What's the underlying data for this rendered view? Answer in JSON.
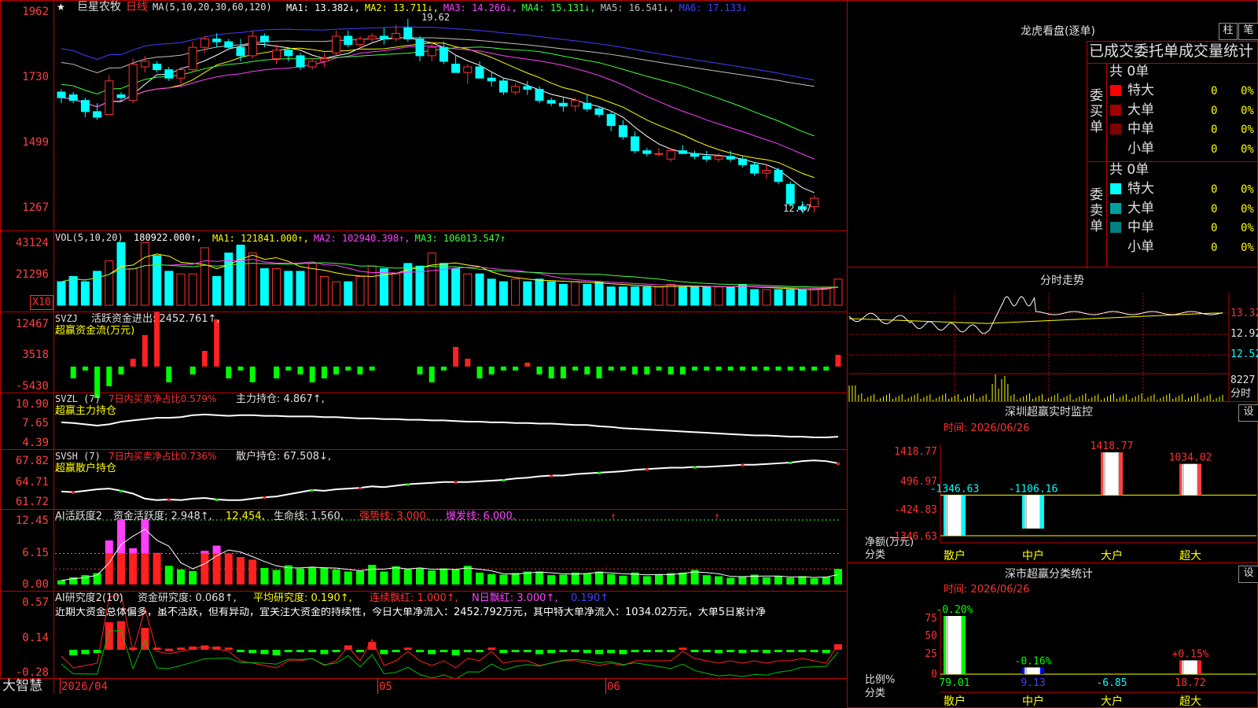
{
  "app": {
    "brand": "大智慧",
    "stock_name": "巨星农牧",
    "period": "日线",
    "star": "★"
  },
  "kline": {
    "y_labels": [
      "1962",
      "1730",
      "1499",
      "1267"
    ],
    "ma_header": "MA(5,10,20,30,60,120)",
    "ma": [
      {
        "label": "MA1: 13.382↓,",
        "color": "#ffffff"
      },
      {
        "label": "MA2: 13.711↓,",
        "color": "#ffff00"
      },
      {
        "label": "MA3: 14.266↓,",
        "color": "#ff40ff"
      },
      {
        "label": "MA4: 15.131↓,",
        "color": "#40ff40"
      },
      {
        "label": "MA5: 16.541↓,",
        "color": "#c0c0c0"
      },
      {
        "label": "MA6: 17.133↓",
        "color": "#4040ff"
      }
    ],
    "high_mark": "19.62",
    "low_mark": "12.67",
    "candles": [
      [
        17.0,
        17.1,
        16.6,
        16.8
      ],
      [
        16.9,
        17.0,
        16.6,
        16.7
      ],
      [
        16.7,
        16.8,
        16.1,
        16.3
      ],
      [
        16.3,
        16.6,
        16.0,
        16.1
      ],
      [
        16.2,
        17.6,
        16.2,
        17.4
      ],
      [
        16.9,
        17.0,
        16.7,
        16.8
      ],
      [
        16.7,
        18.2,
        16.6,
        18.0
      ],
      [
        17.9,
        18.3,
        17.7,
        18.1
      ],
      [
        18.0,
        18.1,
        17.7,
        17.8
      ],
      [
        17.8,
        17.9,
        17.4,
        17.5
      ],
      [
        17.5,
        17.9,
        17.3,
        17.8
      ],
      [
        17.8,
        18.8,
        17.7,
        18.6
      ],
      [
        18.6,
        19.0,
        18.4,
        18.9
      ],
      [
        18.9,
        19.1,
        18.6,
        18.8
      ],
      [
        18.8,
        18.9,
        18.5,
        18.6
      ],
      [
        18.6,
        18.9,
        18.1,
        18.3
      ],
      [
        18.3,
        19.2,
        18.2,
        19.0
      ],
      [
        19.0,
        19.1,
        18.6,
        18.8
      ],
      [
        18.2,
        18.7,
        18.0,
        18.5
      ],
      [
        18.5,
        18.6,
        18.1,
        18.3
      ],
      [
        18.3,
        18.4,
        17.8,
        17.9
      ],
      [
        17.9,
        18.2,
        17.8,
        18.1
      ],
      [
        18.1,
        18.4,
        17.9,
        18.2
      ],
      [
        18.4,
        19.2,
        18.3,
        19.0
      ],
      [
        19.0,
        19.2,
        18.6,
        18.7
      ],
      [
        18.7,
        19.0,
        18.5,
        18.9
      ],
      [
        18.9,
        19.1,
        18.8,
        19.0
      ],
      [
        19.0,
        19.3,
        18.7,
        18.9
      ],
      [
        18.9,
        19.4,
        18.8,
        19.1
      ],
      [
        19.3,
        19.62,
        18.8,
        18.9
      ],
      [
        18.9,
        19.0,
        18.1,
        18.3
      ],
      [
        18.3,
        18.8,
        18.1,
        18.6
      ],
      [
        18.6,
        18.8,
        18.0,
        18.1
      ],
      [
        18.0,
        18.3,
        17.8,
        17.7
      ],
      [
        17.7,
        18.0,
        17.3,
        17.9
      ],
      [
        17.9,
        18.1,
        17.5,
        17.5
      ],
      [
        17.5,
        17.7,
        17.2,
        17.4
      ],
      [
        17.4,
        17.5,
        16.9,
        17.0
      ],
      [
        17.0,
        17.3,
        16.9,
        17.2
      ],
      [
        17.2,
        17.4,
        16.9,
        17.1
      ],
      [
        17.1,
        17.2,
        16.6,
        16.7
      ],
      [
        16.7,
        16.8,
        16.5,
        16.6
      ],
      [
        16.6,
        16.8,
        16.3,
        16.5
      ],
      [
        16.5,
        16.8,
        16.3,
        16.7
      ],
      [
        16.6,
        16.9,
        16.3,
        16.4
      ],
      [
        16.4,
        16.5,
        16.1,
        16.2
      ],
      [
        16.2,
        16.3,
        15.6,
        15.8
      ],
      [
        15.8,
        16.0,
        15.3,
        15.4
      ],
      [
        15.4,
        15.6,
        14.8,
        14.9
      ],
      [
        14.9,
        15.0,
        14.7,
        14.8
      ],
      [
        14.8,
        15.0,
        14.7,
        14.8
      ],
      [
        14.6,
        15.0,
        14.5,
        14.9
      ],
      [
        14.9,
        15.1,
        14.8,
        14.8
      ],
      [
        14.8,
        14.9,
        14.6,
        14.7
      ],
      [
        14.7,
        14.9,
        14.5,
        14.6
      ],
      [
        14.6,
        14.8,
        14.5,
        14.7
      ],
      [
        14.7,
        14.9,
        14.5,
        14.6
      ],
      [
        14.6,
        14.7,
        14.3,
        14.4
      ],
      [
        14.4,
        14.5,
        14.0,
        14.1
      ],
      [
        14.1,
        14.4,
        13.9,
        14.2
      ],
      [
        14.2,
        14.3,
        13.7,
        13.8
      ],
      [
        13.7,
        13.8,
        12.9,
        13.0
      ],
      [
        12.9,
        13.1,
        12.67,
        12.8
      ],
      [
        12.9,
        13.3,
        12.7,
        13.2
      ]
    ]
  },
  "vol": {
    "header": "VOL(5,10,20)",
    "value": "180922.000↑,",
    "ma": [
      {
        "label": "MA1: 121841.000↑,",
        "color": "#ffff00"
      },
      {
        "label": "MA2: 102940.398↑,",
        "color": "#ff40ff"
      },
      {
        "label": "MA3: 106013.547↑",
        "color": "#40ff40"
      }
    ],
    "y_labels": [
      "43124",
      "21296",
      "X10"
    ],
    "bars": [
      9,
      11,
      9,
      13,
      17,
      24,
      14,
      24,
      19,
      13,
      12,
      12,
      22,
      11,
      20,
      23,
      20,
      14,
      14,
      13,
      13,
      16,
      11,
      9,
      9,
      11,
      15,
      14,
      12,
      16,
      15,
      20,
      16,
      14,
      12,
      12,
      10,
      9,
      10,
      9,
      10,
      9,
      8,
      9,
      8,
      9,
      7,
      7,
      7,
      7,
      7,
      8,
      7,
      7,
      7,
      7,
      7,
      8,
      6,
      6,
      6,
      6,
      6,
      6,
      7,
      10
    ]
  },
  "svzj": {
    "title": "SVZJ",
    "line1": "活跃资金进出: 2452.761↑,",
    "line2": "超赢资金流(万元)",
    "y_labels": [
      "12467",
      "3518",
      "-5430"
    ],
    "bars": [
      0,
      -3,
      -1,
      -8,
      -5,
      -2,
      2,
      8,
      14,
      -4,
      0,
      -2,
      4,
      12,
      -3,
      -1,
      -4,
      0,
      -3,
      -1,
      -2,
      -4,
      -3,
      -2,
      -1,
      -2,
      -1,
      0,
      0,
      0,
      -2,
      -4,
      -1,
      5,
      2,
      -3,
      -2,
      -1,
      -1,
      1,
      -2,
      -3,
      -3,
      -1,
      -2,
      -3,
      -1,
      -1,
      -2,
      -2,
      -1,
      -2,
      -2,
      -1,
      -1,
      -1,
      -1,
      -1,
      -1,
      -1,
      -1,
      -1,
      -1,
      -1,
      -1,
      3
    ],
    "bar_colors": [
      "#00ff00",
      "#ff2020"
    ]
  },
  "svzl": {
    "title": "SVZL (7)",
    "text_red": "7日内买卖净占比0.579%",
    "text": "主力持仓: 4.867↑,",
    "line2": "超赢主力持仓",
    "y_labels": [
      "10.90",
      "7.65",
      "4.39"
    ],
    "series": [
      7.9,
      7.8,
      7.6,
      7.4,
      7.6,
      8.0,
      8.2,
      8.4,
      8.6,
      8.6,
      8.7,
      9.0,
      9.1,
      9.0,
      8.9,
      9.0,
      9.0,
      8.9,
      8.9,
      8.8,
      8.8,
      8.8,
      8.7,
      8.7,
      8.6,
      8.5,
      8.5,
      8.4,
      8.4,
      8.3,
      8.3,
      8.2,
      8.2,
      8.1,
      8.0,
      8.0,
      7.9,
      7.9,
      7.8,
      7.8,
      7.7,
      7.7,
      7.6,
      7.5,
      7.5,
      7.3,
      7.2,
      7.0,
      6.9,
      6.8,
      6.7,
      6.6,
      6.5,
      6.4,
      6.3,
      6.2,
      6.1,
      6.0,
      5.9,
      5.9,
      5.8,
      5.7,
      5.7,
      5.6,
      5.6,
      5.7
    ]
  },
  "svsh": {
    "title": "SVSH (7)",
    "text_red": "7日内买卖净占比0.736%",
    "text": "散户持仓: 67.508↓,",
    "line2": "超赢散户持仓",
    "y_labels": [
      "67.82",
      "64.71",
      "61.72"
    ],
    "series": [
      63.6,
      63.5,
      63.7,
      63.9,
      64.0,
      63.7,
      63.3,
      62.6,
      62.4,
      62.5,
      62.4,
      62.6,
      62.7,
      62.5,
      62.4,
      62.4,
      62.6,
      62.8,
      62.9,
      63.2,
      63.5,
      63.8,
      63.7,
      63.9,
      64.0,
      64.1,
      64.3,
      64.2,
      64.4,
      64.6,
      64.7,
      64.8,
      64.9,
      64.9,
      64.9,
      65.0,
      65.1,
      65.2,
      65.4,
      65.5,
      65.7,
      65.8,
      65.8,
      66.0,
      66.1,
      66.2,
      66.3,
      66.4,
      66.6,
      66.7,
      66.8,
      66.9,
      66.9,
      67.0,
      67.0,
      67.1,
      67.2,
      67.3,
      67.3,
      67.4,
      67.5,
      67.6,
      67.8,
      67.9,
      67.8,
      67.5
    ]
  },
  "ai_active": {
    "title": "AI活跃度2",
    "line1": "资金活跃度: 2.948↑,",
    "val2": "12.454,",
    "life": "生命线: 1.560,",
    "strong": "强势线: 3.000,",
    "burst": "爆发线: 6.000,",
    "y_labels": [
      "12.45",
      "6.15",
      "0.00"
    ],
    "bars": [
      0.8,
      1.4,
      1.8,
      2.2,
      8.5,
      12.5,
      7.0,
      12.5,
      6.1,
      3.6,
      2.9,
      2.6,
      6.5,
      7.5,
      6.0,
      5.3,
      4.8,
      3.2,
      2.8,
      3.7,
      3.1,
      3.3,
      3.3,
      2.9,
      2.5,
      2.6,
      3.8,
      2.5,
      3.5,
      3.0,
      3.1,
      2.7,
      3.1,
      2.9,
      3.6,
      2.3,
      2.0,
      1.9,
      2.2,
      2.5,
      2.5,
      1.8,
      1.9,
      2.3,
      2.2,
      2.5,
      2.0,
      1.7,
      2.3,
      1.6,
      1.9,
      2.2,
      2.3,
      2.8,
      1.8,
      1.6,
      1.3,
      1.6,
      1.9,
      1.4,
      1.6,
      1.3,
      1.6,
      1.2,
      1.5,
      3.0
    ]
  },
  "ai_research": {
    "title": "AI研究度2(10)",
    "line1": "资金研究度: 0.068↑,",
    "avg": "平均研究度: 0.190↑,",
    "cont": "连续飘红: 1.000↑,",
    "nday": "N日飘红: 3.000↑,",
    "last": "0.190↑",
    "comment": "近期大资金总体偏多，虽不活跃，但有异动，宜关注大资金的持续性，今日大单净流入：2452.792万元，其中特大单净流入：1034.02万元，大单5日累计净",
    "y_labels": [
      "0.57",
      "0.14",
      "-0.28"
    ],
    "bars": [
      0,
      -0.05,
      -0.04,
      -0.03,
      0.25,
      0.26,
      0.02,
      0.2,
      0.02,
      0.01,
      0.02,
      0.03,
      0.04,
      0.03,
      0.02,
      -0.02,
      -0.03,
      -0.04,
      -0.05,
      -0.02,
      -0.02,
      -0.01,
      -0.04,
      -0.02,
      0.04,
      -0.02,
      0.07,
      -0.04,
      -0.02,
      0.02,
      -0.02,
      -0.04,
      -0.02,
      -0.05,
      -0.01,
      -0.02,
      0.02,
      -0.03,
      -0.02,
      -0.02,
      -0.04,
      -0.03,
      -0.02,
      -0.02,
      -0.03,
      -0.04,
      -0.03,
      -0.04,
      -0.02,
      -0.02,
      -0.02,
      -0.02,
      0.02,
      -0.01,
      -0.02,
      -0.03,
      -0.02,
      -0.03,
      -0.02,
      -0.03,
      -0.02,
      -0.02,
      -0.01,
      -0.02,
      -0.03,
      0.05
    ],
    "x_labels": [
      "2026/04",
      "05",
      "06"
    ]
  },
  "lhb": {
    "title": "龙虎看盘(逐单)",
    "btn_bar": "柱",
    "btn_pen": "笔",
    "subtitle": "已成交委托单成交量统计",
    "buy_label": "委买单",
    "sell_label": "委卖单",
    "buy_total": "共 0单",
    "sell_total": "共 0单",
    "buy_rows": [
      {
        "name": "特大",
        "count": "0",
        "pct": "0%",
        "color": "#ff0000"
      },
      {
        "name": "大单",
        "count": "0",
        "pct": "0%",
        "color": "#a00000"
      },
      {
        "name": "中单",
        "count": "0",
        "pct": "0%",
        "color": "#800000"
      },
      {
        "name": "小单",
        "count": "0",
        "pct": "0%",
        "color": ""
      }
    ],
    "sell_rows": [
      {
        "name": "特大",
        "count": "0",
        "pct": "0%",
        "color": "#00ffff"
      },
      {
        "name": "大单",
        "count": "0",
        "pct": "0%",
        "color": "#00a0a0"
      },
      {
        "name": "中单",
        "count": "0",
        "pct": "0%",
        "color": "#008080"
      },
      {
        "name": "小单",
        "count": "0",
        "pct": "0%",
        "color": ""
      }
    ]
  },
  "intraday": {
    "title": "分时走势",
    "y_labels": [
      "13.32",
      "12.92",
      "12.52"
    ],
    "vol_label": "8227",
    "vol_unit": "分时"
  },
  "sz_monitor": {
    "title": "深圳超赢实时监控",
    "btn": "设",
    "date": "时间: 2026/06/26",
    "y_labels": [
      "1418.77",
      "496.97",
      "-424.83",
      "-1346.63"
    ],
    "axis_title1": "净额(万元)",
    "axis_title2": "分类",
    "bars": [
      {
        "cat": "散户",
        "value": -1346.63,
        "label": "-1346.63",
        "color": "#00ffff"
      },
      {
        "cat": "中户",
        "value": -1106.16,
        "label": "-1106.16",
        "color": "#00ffff"
      },
      {
        "cat": "大户",
        "value": 1418.77,
        "label": "1418.77",
        "color": "#ff4040"
      },
      {
        "cat": "超大",
        "value": 1034.02,
        "label": "1034.02",
        "color": "#ff4040"
      }
    ]
  },
  "sz_class": {
    "title": "深市超赢分类统计",
    "btn": "设",
    "date": "时间: 2026/06/26",
    "y_labels": [
      "75",
      "50",
      "25",
      "0"
    ],
    "axis_title1": "比例%",
    "axis_title2": "分类",
    "bars": [
      {
        "cat": "散户",
        "value": 79.01,
        "top": "-0.20%",
        "bottom": "79.01",
        "color": "#00ff00"
      },
      {
        "cat": "中户",
        "value": 9.13,
        "top": "-0.16%",
        "bottom": "9.13",
        "color": "#0000ff"
      },
      {
        "cat": "大户",
        "value": 0,
        "top": "",
        "bottom": "-6.85",
        "color": "#00ffff"
      },
      {
        "cat": "超大",
        "value": 18.72,
        "top": "+0.15%",
        "bottom": "18.72",
        "color": "#ff2020"
      }
    ]
  }
}
